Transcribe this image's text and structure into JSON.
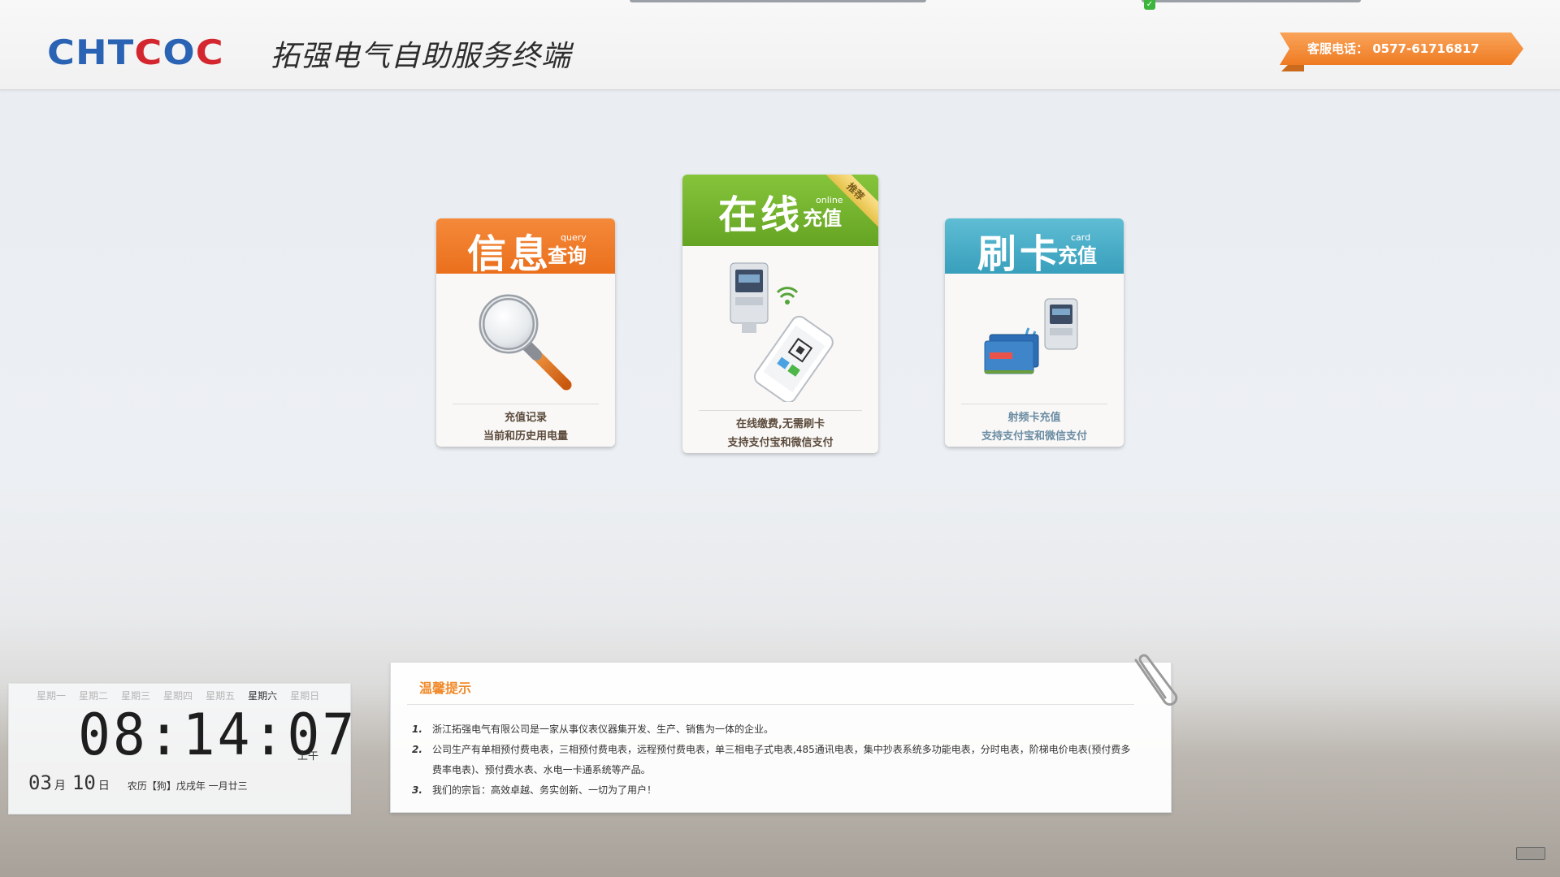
{
  "header": {
    "logo_text_a": "CH",
    "logo_text_b": "T",
    "logo_text_c": "C",
    "logo_text_d": "O",
    "logo_text_e": "C",
    "title": "拓强电气自助服务终端",
    "hotline": "客服电话： 0577-61716817"
  },
  "cards": {
    "query": {
      "big": "信息",
      "small": "查询",
      "en": "query",
      "line1": "充值记录",
      "line2": "当前和历史用电量",
      "color": "#ef7a24"
    },
    "online": {
      "big": "在线",
      "small": "充值",
      "en": "online",
      "ribbon": "推荐",
      "line1": "在线缴费,无需刷卡",
      "line2": "支持支付宝和微信支付",
      "color": "#74b02d"
    },
    "card": {
      "big": "刷卡",
      "small": "充值",
      "en": "card",
      "line1": "射频卡充值",
      "line2": "支持支付宝和微信支付",
      "color": "#42a9c4"
    }
  },
  "clock": {
    "weekdays": [
      "星期一",
      "星期二",
      "星期三",
      "星期四",
      "星期五",
      "星期六",
      "星期日"
    ],
    "active_weekday": "星期六",
    "time": "08:14:07",
    "ampm": "上午",
    "month": "03",
    "month_unit": "月",
    "day": "10",
    "day_unit": "日",
    "lunar": "农历【狗】戊戌年 一月廿三"
  },
  "notice": {
    "title": "温馨提示",
    "items": [
      {
        "n": "1.",
        "text": "浙江拓强电气有限公司是一家从事仪表仪器集开发、生产、销售为一体的企业。"
      },
      {
        "n": "2.",
        "text": "公司生产有单相预付费电表，三相预付费电表，远程预付费电表，单三相电子式电表,485通讯电表，集中抄表系统多功能电表，分时电表，阶梯电价电表(预付费多费率电表)、预付费水表、水电一卡通系统等产品。"
      },
      {
        "n": "3.",
        "text": "我们的宗旨：高效卓越、务实创新、一切为了用户！"
      }
    ]
  },
  "colors": {
    "accent_orange": "#f08a2a",
    "logo_blue": "#2a63b4",
    "logo_red": "#d3262e"
  }
}
